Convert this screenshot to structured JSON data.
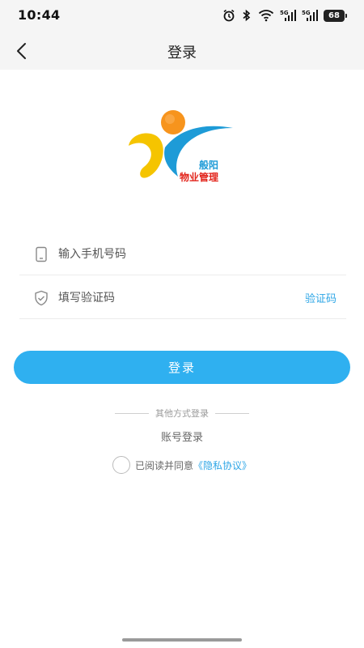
{
  "status_bar": {
    "time": "10:44",
    "battery": "68",
    "icons": [
      "alarm-icon",
      "bluetooth-icon",
      "wifi-icon",
      "signal-5g-icon",
      "signal-5g-icon",
      "battery-icon"
    ]
  },
  "nav": {
    "title": "登录",
    "back_icon": "back-arrow-icon"
  },
  "logo": {
    "line1": "般阳",
    "line2": "物业管理",
    "colors": {
      "orange": "#f7941d",
      "yellow": "#f5c400",
      "blue": "#1e9bd7",
      "red": "#e2231a"
    }
  },
  "form": {
    "phone_placeholder": "输入手机号码",
    "code_placeholder": "填写验证码",
    "code_link": "验证码"
  },
  "login_button": "登录",
  "other_methods": "其他方式登录",
  "account_login": "账号登录",
  "agreement": {
    "prefix": "已阅读并同意",
    "link": "《隐私协议》",
    "checked": false
  },
  "colors": {
    "accent": "#2fb0f0",
    "link": "#2ea6e6",
    "header_bg": "#f5f5f5"
  }
}
